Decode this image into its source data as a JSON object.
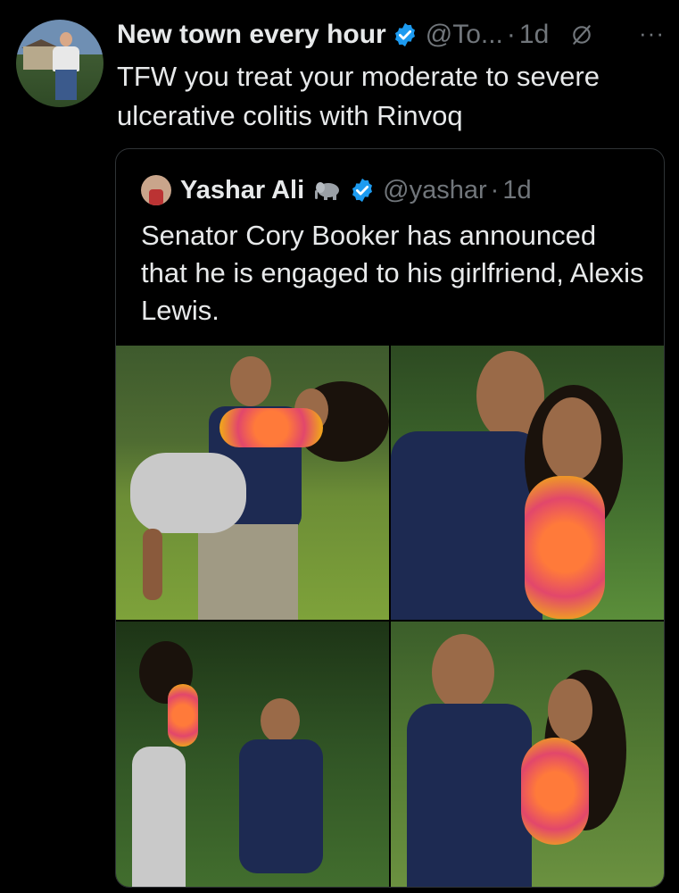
{
  "tweet": {
    "author_name": "New town every hour",
    "author_handle": "@To...",
    "separator": "·",
    "time": "1d",
    "more": "···",
    "text": "TFW you treat your moderate to severe ulcerative colitis with Rinvoq"
  },
  "quoted": {
    "author_name": "Yashar Ali",
    "author_handle": "@yashar",
    "separator": "·",
    "time": "1d",
    "text": "Senator Cory Booker has announced that he is engaged to his girlfriend, Alexis Lewis."
  },
  "icons": {
    "verified": "verified-badge-icon",
    "grok": "grok-icon",
    "more": "more-icon",
    "elephant": "elephant-icon"
  },
  "colors": {
    "background": "#000000",
    "text": "#e7e9ea",
    "muted": "#71767b",
    "verified": "#1d9bf0",
    "border": "#2f3336"
  }
}
